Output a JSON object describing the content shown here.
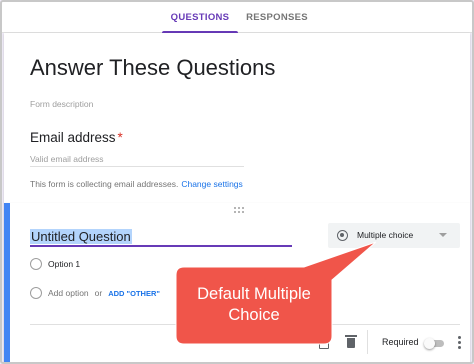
{
  "tabs": {
    "questions": "QUESTIONS",
    "responses": "RESPONSES"
  },
  "form": {
    "title": "Answer These Questions",
    "description_placeholder": "Form description",
    "email_label": "Email address",
    "required_mark": "*",
    "email_placeholder": "Valid email address",
    "collect_note": "This form is collecting email addresses.",
    "change_settings": "Change settings"
  },
  "question": {
    "title": "Untitled Question",
    "type": "Multiple choice",
    "type_icon": "radio-button-icon",
    "options": [
      "Option 1"
    ],
    "add_option": "Add option",
    "or": "or",
    "add_other": "ADD \"OTHER\"",
    "required_label": "Required",
    "required_on": false
  },
  "annotation": {
    "text_line1": "Default Multiple",
    "text_line2": "Choice"
  },
  "colors": {
    "accent": "#673ab7",
    "background": "#f0ebf8",
    "link": "#1a73e8",
    "active_question_border": "#4285f4",
    "callout": "#f0554a"
  }
}
